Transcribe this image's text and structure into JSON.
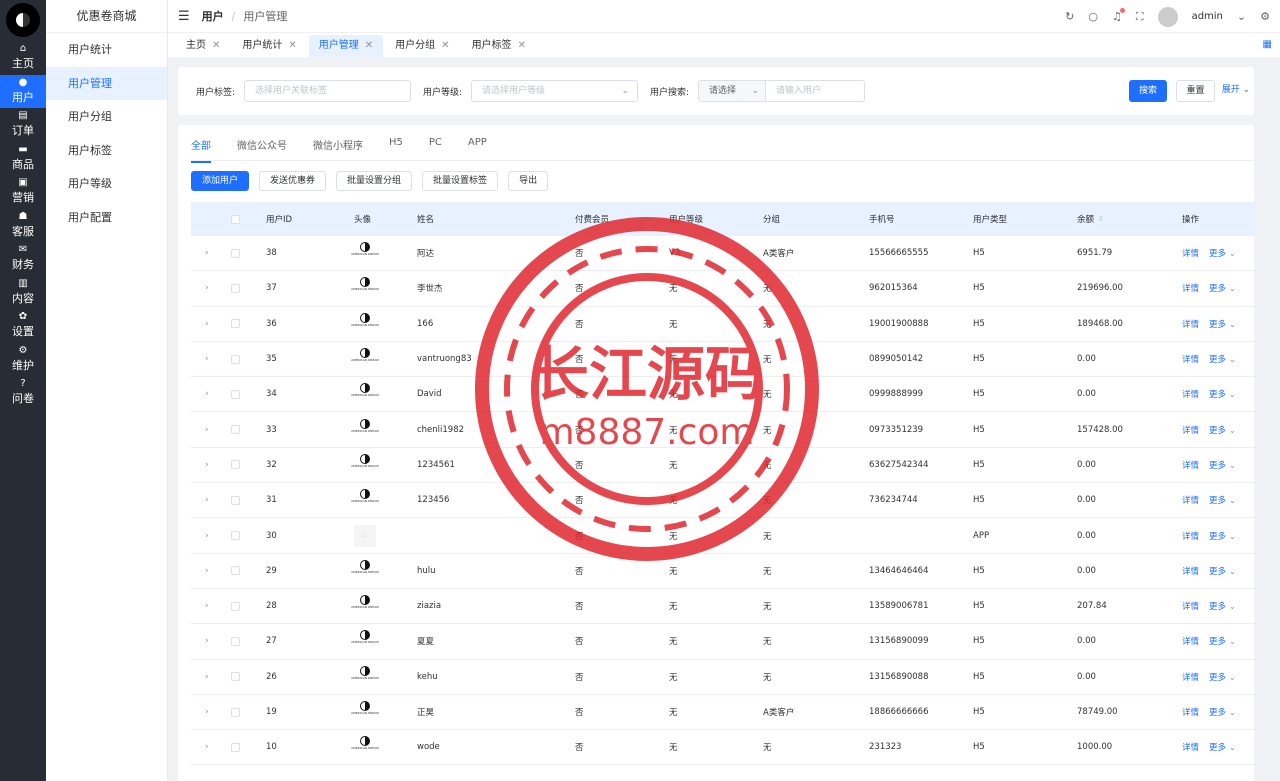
{
  "sidebar": {
    "items": [
      {
        "label": "主页",
        "icon": "home-icon"
      },
      {
        "label": "用户",
        "icon": "user-icon"
      },
      {
        "label": "订单",
        "icon": "order-icon"
      },
      {
        "label": "商品",
        "icon": "goods-icon"
      },
      {
        "label": "营销",
        "icon": "marketing-icon"
      },
      {
        "label": "客服",
        "icon": "service-icon"
      },
      {
        "label": "财务",
        "icon": "finance-icon"
      },
      {
        "label": "内容",
        "icon": "content-icon"
      },
      {
        "label": "设置",
        "icon": "settings-icon"
      },
      {
        "label": "维护",
        "icon": "maintain-icon"
      },
      {
        "label": "问卷",
        "icon": "question-icon"
      }
    ],
    "active": "用户"
  },
  "submenu": {
    "title": "优惠卷商城",
    "items": [
      "用户统计",
      "用户管理",
      "用户分组",
      "用户标签",
      "用户等级",
      "用户配置"
    ],
    "active": "用户管理"
  },
  "header": {
    "crumb1": "用户",
    "sep": "/",
    "crumb2": "用户管理",
    "username": "admin"
  },
  "tabs": [
    {
      "label": "主页"
    },
    {
      "label": "用户统计"
    },
    {
      "label": "用户管理",
      "active": true
    },
    {
      "label": "用户分组"
    },
    {
      "label": "用户标签"
    }
  ],
  "filter": {
    "tag_label": "用户标签:",
    "tag_placeholder": "选择用户关联标签",
    "level_label": "用户等级:",
    "level_placeholder": "请选择用户等级",
    "search_label": "用户搜索:",
    "search_select": "请选择",
    "search_placeholder": "请输入用户",
    "search_btn": "搜索",
    "reset_btn": "重置",
    "expand_btn": "展开"
  },
  "content_tabs": [
    "全部",
    "微信公众号",
    "微信小程序",
    "H5",
    "PC",
    "APP"
  ],
  "actions": [
    "添加用户",
    "发送优惠券",
    "批量设置分组",
    "批量设置标签",
    "导出"
  ],
  "table": {
    "headers": {
      "id": "用户ID",
      "avatar": "头像",
      "name": "姓名",
      "member": "付费会员",
      "level": "用户等级",
      "group": "分组",
      "phone": "手机号",
      "type": "用户类型",
      "balance": "余额",
      "ops": "操作"
    },
    "detail": "详情",
    "more": "更多",
    "avatar_text": "AMERICAN DREAM",
    "rows": [
      {
        "id": "38",
        "name": "阿达",
        "member": "否",
        "level": "V3",
        "group": "A类客户",
        "phone": "15566665555",
        "type": "H5",
        "balance": "6951.79"
      },
      {
        "id": "37",
        "name": "李世杰",
        "member": "否",
        "level": "无",
        "group": "无",
        "phone": "962015364",
        "type": "H5",
        "balance": "219696.00"
      },
      {
        "id": "36",
        "name": "166",
        "member": "否",
        "level": "无",
        "group": "无",
        "phone": "19001900888",
        "type": "H5",
        "balance": "189468.00"
      },
      {
        "id": "35",
        "name": "vantruong83",
        "member": "否",
        "level": "无",
        "group": "无",
        "phone": "0899050142",
        "type": "H5",
        "balance": "0.00"
      },
      {
        "id": "34",
        "name": "David",
        "member": "否",
        "level": "无",
        "group": "无",
        "phone": "0999888999",
        "type": "H5",
        "balance": "0.00"
      },
      {
        "id": "33",
        "name": "chenli1982",
        "member": "否",
        "level": "无",
        "group": "无",
        "phone": "0973351239",
        "type": "H5",
        "balance": "157428.00"
      },
      {
        "id": "32",
        "name": "1234561",
        "member": "否",
        "level": "无",
        "group": "无",
        "phone": "63627542344",
        "type": "H5",
        "balance": "0.00"
      },
      {
        "id": "31",
        "name": "123456",
        "member": "否",
        "level": "无",
        "group": "无",
        "phone": "736234744",
        "type": "H5",
        "balance": "0.00"
      },
      {
        "id": "30",
        "name": "",
        "member": "否",
        "level": "无",
        "group": "无",
        "phone": "",
        "type": "APP",
        "balance": "0.00",
        "blank_avatar": true
      },
      {
        "id": "29",
        "name": "hulu",
        "member": "否",
        "level": "无",
        "group": "无",
        "phone": "13464646464",
        "type": "H5",
        "balance": "0.00"
      },
      {
        "id": "28",
        "name": "ziazia",
        "member": "否",
        "level": "无",
        "group": "无",
        "phone": "13589006781",
        "type": "H5",
        "balance": "207.84"
      },
      {
        "id": "27",
        "name": "夏夏",
        "member": "否",
        "level": "无",
        "group": "无",
        "phone": "13156890099",
        "type": "H5",
        "balance": "0.00"
      },
      {
        "id": "26",
        "name": "kehu",
        "member": "否",
        "level": "无",
        "group": "无",
        "phone": "13156890088",
        "type": "H5",
        "balance": "0.00"
      },
      {
        "id": "19",
        "name": "正昊",
        "member": "否",
        "level": "无",
        "group": "A类客户",
        "phone": "18866666666",
        "type": "H5",
        "balance": "78749.00"
      },
      {
        "id": "10",
        "name": "wode",
        "member": "否",
        "level": "无",
        "group": "无",
        "phone": "231323",
        "type": "H5",
        "balance": "1000.00"
      }
    ]
  },
  "watermark": {
    "line1": "长江源码",
    "line2": "m8887.com",
    "color": "#e0282e"
  },
  "colors": {
    "primary": "#1e6fff",
    "rail": "#282c35"
  }
}
